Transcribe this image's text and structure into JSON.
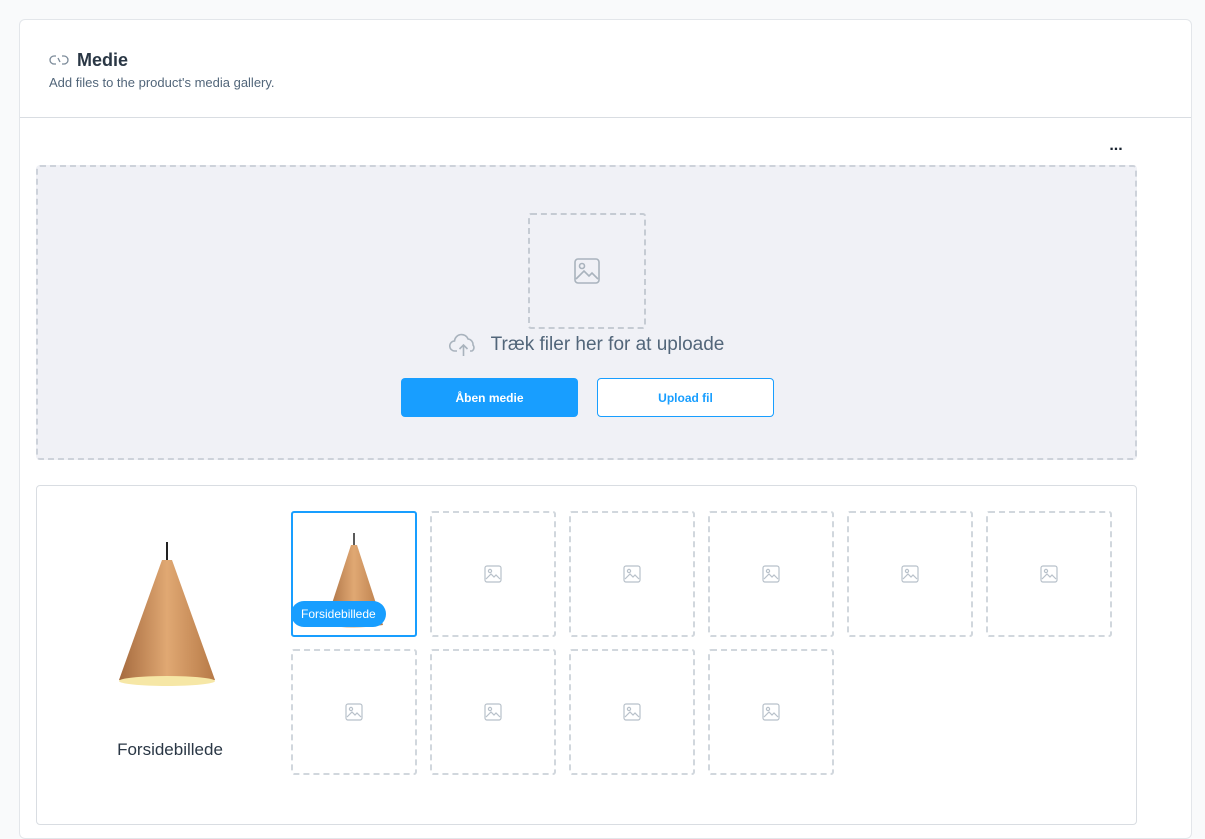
{
  "card": {
    "title": "Medie",
    "subtitle": "Add files to the product's media gallery.",
    "title_icon": "link-icon"
  },
  "toolbar": {
    "more_label": "..."
  },
  "dropzone": {
    "text": "Træk filer her for at uploade",
    "open_media_label": "Åben medie",
    "upload_label": "Upload fil",
    "icon": "cloud-upload-icon"
  },
  "gallery": {
    "cover_label": "Forsidebillede",
    "cover_badge": "Forsidebillede",
    "slots_total": 10,
    "slots_filled": 1
  },
  "colors": {
    "accent": "#189eff",
    "text_primary": "#2a3745",
    "text_secondary": "#52667a",
    "dropzone_bg": "#f0f1f6"
  }
}
